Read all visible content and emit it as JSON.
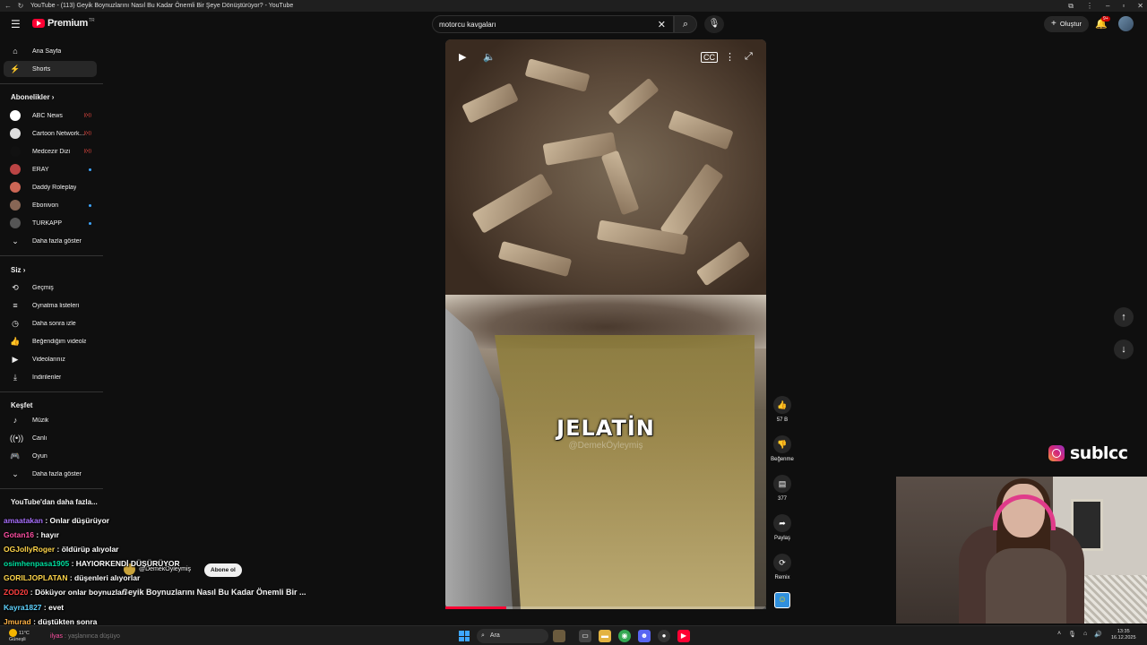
{
  "window": {
    "title": "YouTube - (113) Geyik Boynuzlarını Nasıl Bu Kadar Önemli Bir Şeye Dönüştürüyor? - YouTube"
  },
  "masthead": {
    "logo_text": "Premium",
    "logo_sup": "TR",
    "search_value": "motorcu kavgaları",
    "create_label": "Oluştur",
    "notif_count": "9+"
  },
  "sidebar": {
    "nav": [
      {
        "label": "Ana Sayfa",
        "icon": "home-icon"
      },
      {
        "label": "Shorts",
        "icon": "shorts-icon",
        "active": true
      }
    ],
    "subscriptions_header": "Abonelikler",
    "subscriptions": [
      {
        "label": "ABC News",
        "status": "live"
      },
      {
        "label": "Cartoon Network...",
        "status": "live"
      },
      {
        "label": "Medcezir Dizi",
        "status": "live"
      },
      {
        "label": "ERAY",
        "status": "dot"
      },
      {
        "label": "Daddy Roleplay",
        "status": ""
      },
      {
        "label": "Ebonivon",
        "status": "dot"
      },
      {
        "label": "TÜRKAPP",
        "status": "dot"
      }
    ],
    "subs_more": "Daha fazla göster",
    "you_header": "Siz",
    "you": [
      {
        "label": "Geçmiş",
        "icon": "history-icon"
      },
      {
        "label": "Oynatma listeleri",
        "icon": "playlists-icon"
      },
      {
        "label": "Daha sonra izle",
        "icon": "watch-later-icon"
      },
      {
        "label": "Beğendiğim videolar",
        "icon": "liked-icon"
      },
      {
        "label": "Videolarınız",
        "icon": "your-videos-icon"
      },
      {
        "label": "İndirilenler",
        "icon": "downloads-icon"
      }
    ],
    "explore_header": "Keşfet",
    "explore": [
      {
        "label": "Müzik",
        "icon": "music-icon"
      },
      {
        "label": "Canlı",
        "icon": "live-icon"
      },
      {
        "label": "Oyun",
        "icon": "gaming-icon"
      }
    ],
    "explore_more": "Daha fazla göster",
    "more_header": "YouTube'dan daha fazla..."
  },
  "short": {
    "overlay_text": "JELATİN",
    "watermark": "@DemekÖyleymiş",
    "progress": 0.19,
    "channel": "@DemekÖyleymiş",
    "subscribe_label": "Abone ol",
    "title": "Geyik Boynuzlarını Nasıl Bu Kadar Önemli Bir ..."
  },
  "actions": {
    "likes": "57 B",
    "dislike_label": "Beğenme",
    "comments": "377",
    "share_label": "Paylaş",
    "remix_label": "Remix"
  },
  "stream": {
    "brand": "sublcc"
  },
  "chat": [
    {
      "user": "amaatakan",
      "color": "#a970ff",
      "text": "Onlar düşürüyor"
    },
    {
      "user": "Gotan16",
      "color": "#ff4fa3",
      "text": "hayır"
    },
    {
      "user": "OGJollyRoger",
      "color": "#ffd54a",
      "text": "öldürüp alıyolar"
    },
    {
      "user": "osimhenpasa1905",
      "color": "#00e0a0",
      "text": "HAYIORKENDİ DÜŞÜRÜYOR"
    },
    {
      "user": "GORILJOPLATAN",
      "color": "#ffd54a",
      "text": "düşenleri alıyorlar"
    },
    {
      "user": "ZOD20",
      "color": "#ff4040",
      "text": "Döküyor onlar boynuzları"
    },
    {
      "user": "Kayra1827",
      "color": "#5fd3ff",
      "text": "evet"
    },
    {
      "user": "Jmurad",
      "color": "#ffb347",
      "text": "düştükten sonra"
    },
    {
      "user": "ilyas",
      "color": "#ff4fa3",
      "text": "yaşlanınca düşüyo"
    }
  ],
  "taskbar": {
    "temp": "11°C",
    "weather": "Güneşli",
    "search_label": "Ara",
    "time": "13:35",
    "date": "16.12.2025"
  }
}
